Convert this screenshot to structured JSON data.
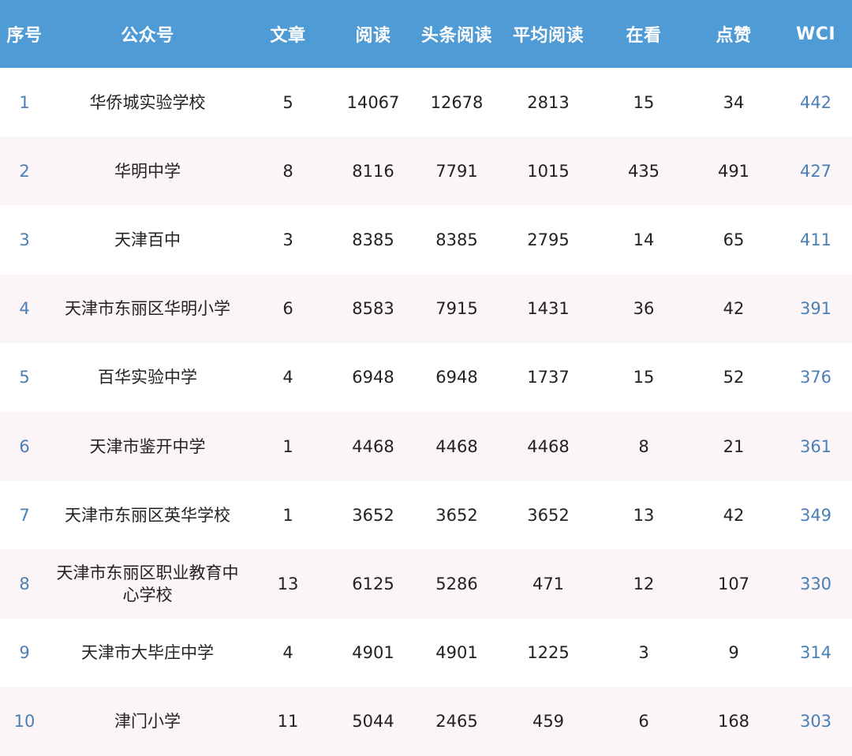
{
  "table": {
    "headers": [
      "序号",
      "公众号",
      "文章",
      "阅读",
      "头条阅读",
      "平均阅读",
      "在看",
      "点赞",
      "WCI"
    ],
    "rows": [
      {
        "rank": "1",
        "name": "华侨城实验学校",
        "articles": "5",
        "reads": "14067",
        "headline_reads": "12678",
        "avg_reads": "2813",
        "watching": "15",
        "likes": "34",
        "wci": "442"
      },
      {
        "rank": "2",
        "name": "华明中学",
        "articles": "8",
        "reads": "8116",
        "headline_reads": "7791",
        "avg_reads": "1015",
        "watching": "435",
        "likes": "491",
        "wci": "427"
      },
      {
        "rank": "3",
        "name": "天津百中",
        "articles": "3",
        "reads": "8385",
        "headline_reads": "8385",
        "avg_reads": "2795",
        "watching": "14",
        "likes": "65",
        "wci": "411"
      },
      {
        "rank": "4",
        "name": "天津市东丽区华明小学",
        "articles": "6",
        "reads": "8583",
        "headline_reads": "7915",
        "avg_reads": "1431",
        "watching": "36",
        "likes": "42",
        "wci": "391"
      },
      {
        "rank": "5",
        "name": "百华实验中学",
        "articles": "4",
        "reads": "6948",
        "headline_reads": "6948",
        "avg_reads": "1737",
        "watching": "15",
        "likes": "52",
        "wci": "376"
      },
      {
        "rank": "6",
        "name": "天津市鉴开中学",
        "articles": "1",
        "reads": "4468",
        "headline_reads": "4468",
        "avg_reads": "4468",
        "watching": "8",
        "likes": "21",
        "wci": "361"
      },
      {
        "rank": "7",
        "name": "天津市东丽区英华学校",
        "articles": "1",
        "reads": "3652",
        "headline_reads": "3652",
        "avg_reads": "3652",
        "watching": "13",
        "likes": "42",
        "wci": "349"
      },
      {
        "rank": "8",
        "name": "天津市东丽区职业教育中心学校",
        "articles": "13",
        "reads": "6125",
        "headline_reads": "5286",
        "avg_reads": "471",
        "watching": "12",
        "likes": "107",
        "wci": "330"
      },
      {
        "rank": "9",
        "name": "天津市大毕庄中学",
        "articles": "4",
        "reads": "4901",
        "headline_reads": "4901",
        "avg_reads": "1225",
        "watching": "3",
        "likes": "9",
        "wci": "314"
      },
      {
        "rank": "10",
        "name": "津门小学",
        "articles": "11",
        "reads": "5044",
        "headline_reads": "2465",
        "avg_reads": "459",
        "watching": "6",
        "likes": "168",
        "wci": "303"
      }
    ]
  },
  "colors": {
    "header_bg": "#4f9bd5",
    "row_alt_bg": "#fbf5f8",
    "rank_text": "#4a7fb5",
    "wci_text": "#4a7fb5"
  }
}
